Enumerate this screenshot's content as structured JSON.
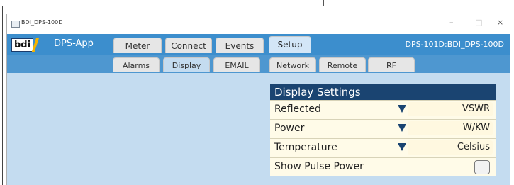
{
  "window": {
    "title": "BDI_DPS-100D",
    "controls": {
      "minimize": "–",
      "maximize": "□",
      "close": "×"
    }
  },
  "header": {
    "logo_text": "bdi",
    "app_name": "DPS-App",
    "device_label": "DPS-101D:BDI_DPS-100D",
    "tabs": [
      "Meter",
      "Connect",
      "Events",
      "Setup"
    ],
    "active_tab": "Setup"
  },
  "subtabs": {
    "items": [
      "Alarms",
      "Display",
      "EMAIL",
      "Network",
      "Remote",
      "RF"
    ],
    "active": "Display"
  },
  "display_settings": {
    "title": "Display Settings",
    "rows": [
      {
        "label": "Reflected",
        "value": "VSWR"
      },
      {
        "label": "Power",
        "value": "W/KW"
      },
      {
        "label": "Temperature",
        "value": "Celsius"
      }
    ],
    "pulse": {
      "label": "Show Pulse Power",
      "checked": false
    }
  },
  "colors": {
    "header_bg": "#3c8ecd",
    "panel_header": "#1a4471",
    "body_bg": "#c4dcf0",
    "row_bg": "#fffbe8"
  }
}
